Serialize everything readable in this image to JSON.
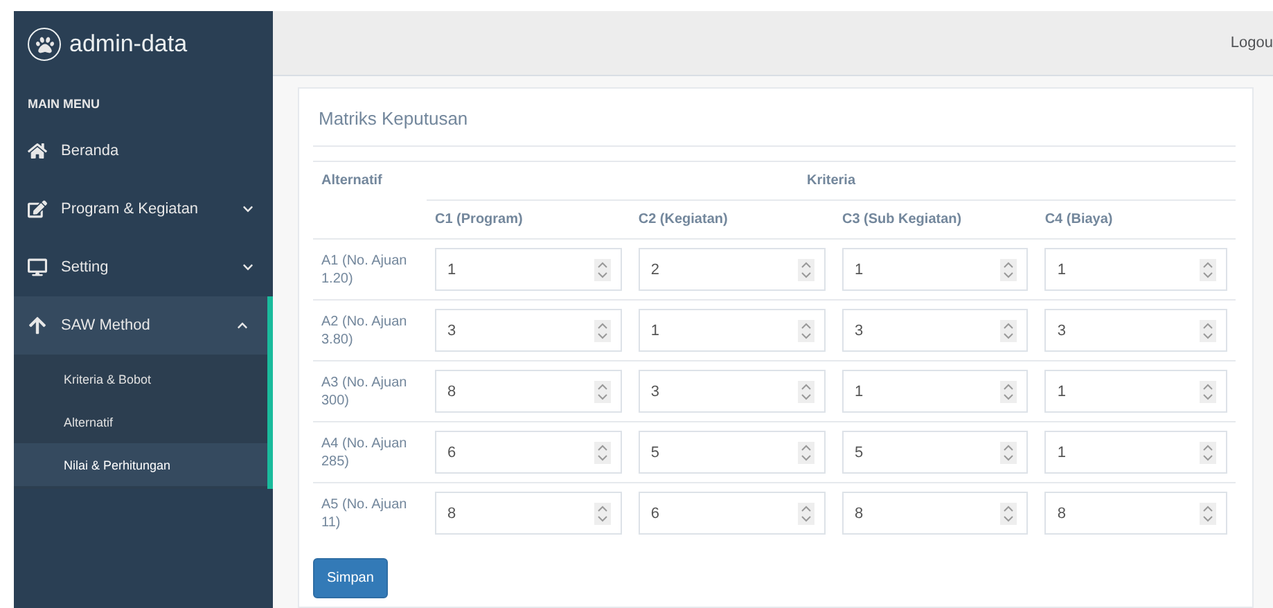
{
  "brand": "admin-data",
  "header": {
    "logout": "Logou"
  },
  "sidebar": {
    "section": "MAIN MENU",
    "items": [
      {
        "label": "Beranda",
        "active": false
      },
      {
        "label": "Program & Kegiatan",
        "expanded": false,
        "active": false
      },
      {
        "label": "Setting",
        "expanded": false,
        "active": false
      },
      {
        "label": "SAW Method",
        "expanded": true,
        "active": true,
        "children": [
          {
            "label": "Kriteria & Bobot",
            "selected": false
          },
          {
            "label": "Alternatif",
            "selected": false
          },
          {
            "label": "Nilai & Perhitungan",
            "selected": true
          }
        ]
      }
    ]
  },
  "panel": {
    "title": "Matriks Keputusan",
    "table": {
      "alt_header": "Alternatif",
      "group_header": "Kriteria",
      "columns": [
        "C1 (Program)",
        "C2 (Kegiatan)",
        "C3 (Sub Kegiatan)",
        "C4 (Biaya)"
      ],
      "rows": [
        {
          "label": "A1 (No. Ajuan 1.20)",
          "values": [
            "1",
            "2",
            "1",
            "1"
          ]
        },
        {
          "label": "A2 (No. Ajuan 3.80)",
          "values": [
            "3",
            "1",
            "3",
            "3"
          ]
        },
        {
          "label": "A3 (No. Ajuan 300)",
          "values": [
            "8",
            "3",
            "1",
            "1"
          ]
        },
        {
          "label": "A4 (No. Ajuan 285)",
          "values": [
            "6",
            "5",
            "5",
            "1"
          ]
        },
        {
          "label": "A5 (No. Ajuan 11)",
          "values": [
            "8",
            "6",
            "8",
            "8"
          ]
        }
      ]
    },
    "button": "Simpan"
  }
}
